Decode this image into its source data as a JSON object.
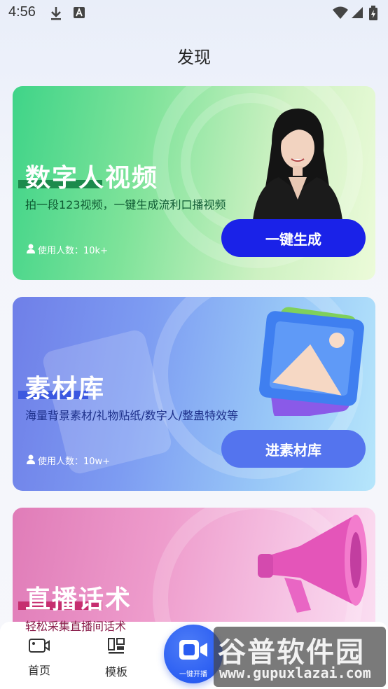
{
  "status_bar": {
    "time": "4:56",
    "icons": [
      "download-icon",
      "a-letter-icon",
      "wifi-icon",
      "signal-icon",
      "battery-icon"
    ]
  },
  "page": {
    "title": "发现"
  },
  "cards": [
    {
      "title": "数字人视频",
      "subtitle": "拍一段123视频，一键生成流利口播视频",
      "users": "使用人数：10k+",
      "button": "一键生成",
      "colors": {
        "button": "#1a22e8",
        "underline": "#1c8a4c",
        "subtitle": "#0f5b33"
      }
    },
    {
      "title": "素材库",
      "subtitle": "海量背景素材/礼物贴纸/数字人/整蛊特效等",
      "users": "使用人数：10w+",
      "button": "进素材库",
      "colors": {
        "button": "#5474ee",
        "underline": "#3b58e0",
        "subtitle": "#1c2f8a"
      }
    },
    {
      "title": "直播话术",
      "subtitle": "轻松采集直播间话术",
      "colors": {
        "underline": "#c62f6f",
        "subtitle": "#8a1f4c"
      }
    }
  ],
  "nav": {
    "items": [
      {
        "label": "首页",
        "icon": "video-camera-icon"
      },
      {
        "label": "模板",
        "icon": "template-icon"
      },
      {
        "label": "一键开播",
        "icon": "live-camera-icon"
      }
    ]
  },
  "watermark": {
    "main": "谷普软件园",
    "url": "www.gupuxlazai.com"
  }
}
